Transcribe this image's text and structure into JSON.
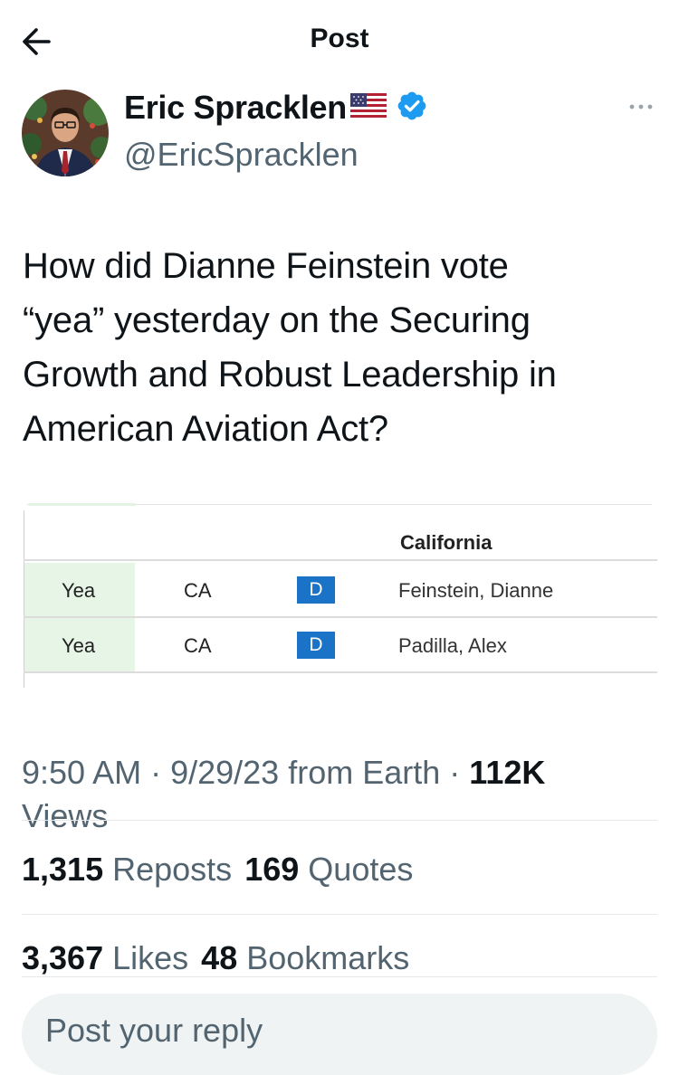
{
  "header": {
    "title": "Post"
  },
  "author": {
    "display_name": "Eric Spracklen",
    "handle": "@EricSpracklen"
  },
  "tweet": {
    "lines": [
      "How did Dianne Feinstein vote",
      "“yea” yesterday on the Securing",
      "Growth and Robust Leadership in",
      "American Aviation Act?"
    ]
  },
  "vote_card": {
    "state_title": "California",
    "rows": [
      {
        "vote": "Yea",
        "state": "CA",
        "party": "D",
        "senator": "Feinstein, Dianne"
      },
      {
        "vote": "Yea",
        "state": "CA",
        "party": "D",
        "senator": "Padilla, Alex"
      }
    ]
  },
  "meta": {
    "time": "9:50 AM",
    "sep1": " · ",
    "date": "9/29/23",
    "source": " from Earth",
    "sep2": " · ",
    "views_count": "112K",
    "views_label": "Views"
  },
  "stats": {
    "reposts_count": "1,315",
    "reposts_label": "Reposts",
    "quotes_count": "169",
    "quotes_label": "Quotes",
    "likes_count": "3,367",
    "likes_label": "Likes",
    "bookmarks_count": "48",
    "bookmarks_label": "Bookmarks"
  },
  "reply": {
    "placeholder": "Post your reply"
  },
  "colors": {
    "verified": "#1d9bf0",
    "party_d": "#1a73c7",
    "yea_bg": "#e6f5e6",
    "secondary_text": "#536471"
  }
}
